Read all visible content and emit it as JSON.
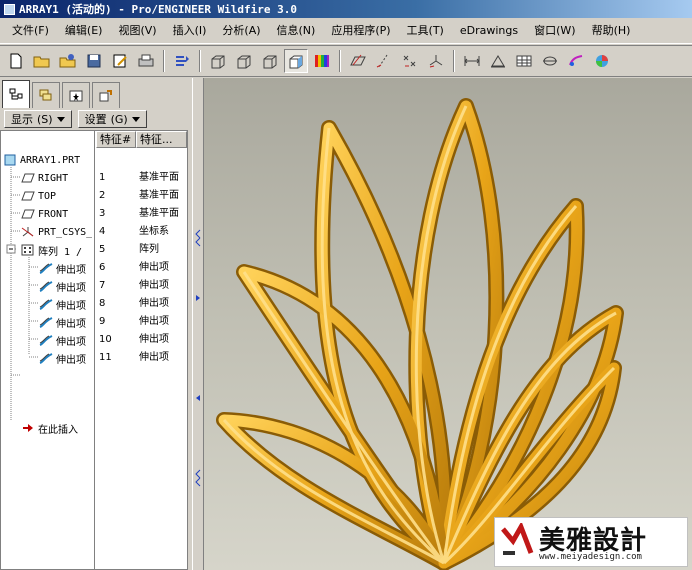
{
  "window": {
    "title": "ARRAY1 (活动的) - Pro/ENGINEER Wildfire 3.0"
  },
  "menu": [
    "文件(F)",
    "编辑(E)",
    "视图(V)",
    "插入(I)",
    "分析(A)",
    "信息(N)",
    "应用程序(P)",
    "工具(T)",
    "eDrawings",
    "窗口(W)",
    "帮助(H)"
  ],
  "toolbar": {
    "icons": [
      "new-file-icon",
      "open-file-icon",
      "open-dir-icon",
      "save-icon",
      "save-copy-icon",
      "print-icon",
      "regenerate-icon",
      "wireframe-icon",
      "hidden-line-icon",
      "no-hidden-icon",
      "shading-icon",
      "color-appearance-icon",
      "datum-plane-icon",
      "datum-axis-icon",
      "datum-point-icon",
      "coordinate-system-icon",
      "measure-icon",
      "mass-properties-icon",
      "table-icon",
      "section-icon",
      "annotation-icon",
      "model-color-icon"
    ]
  },
  "nav": {
    "tabs": [
      "model-tree-tab",
      "layer-tab",
      "favorites-tab",
      "connections-tab"
    ]
  },
  "tree_controls": {
    "show_label": "显示",
    "show_key": "(S)",
    "settings_label": "设置",
    "settings_key": "(G)"
  },
  "tree": {
    "col_feature_num": "特征#",
    "col_feature_type": "特征...",
    "root": "ARRAY1.PRT",
    "rows": [
      {
        "name": "RIGHT",
        "num": "1",
        "type": "基准平面",
        "icon": "datum-plane-icon"
      },
      {
        "name": "TOP",
        "num": "2",
        "type": "基准平面",
        "icon": "datum-plane-icon"
      },
      {
        "name": "FRONT",
        "num": "3",
        "type": "基准平面",
        "icon": "datum-plane-icon"
      },
      {
        "name": "PRT_CSYS_",
        "num": "4",
        "type": "坐标系",
        "icon": "coordinate-system-icon"
      },
      {
        "name": "阵列 1 /",
        "num": "5",
        "type": "阵列",
        "icon": "pattern-icon"
      },
      {
        "name": "伸出项",
        "num": "6",
        "type": "伸出项",
        "icon": "protrusion-icon"
      },
      {
        "name": "伸出项",
        "num": "7",
        "type": "伸出项",
        "icon": "protrusion-icon"
      },
      {
        "name": "伸出项",
        "num": "8",
        "type": "伸出项",
        "icon": "protrusion-icon"
      },
      {
        "name": "伸出项",
        "num": "9",
        "type": "伸出项",
        "icon": "protrusion-icon"
      },
      {
        "name": "伸出项",
        "num": "10",
        "type": "伸出项",
        "icon": "protrusion-icon"
      },
      {
        "name": "伸出项",
        "num": "11",
        "type": "伸出项",
        "icon": "protrusion-icon"
      }
    ],
    "insert_here": "在此插入"
  },
  "watermark": {
    "brand": "美雅設計",
    "url": "www.meiyadesign.com"
  },
  "colors": {
    "model_fill": "#e8a418",
    "model_dark": "#9c6a08",
    "model_light": "#ffd25a",
    "viewport_bg": "#c1c0b4"
  }
}
